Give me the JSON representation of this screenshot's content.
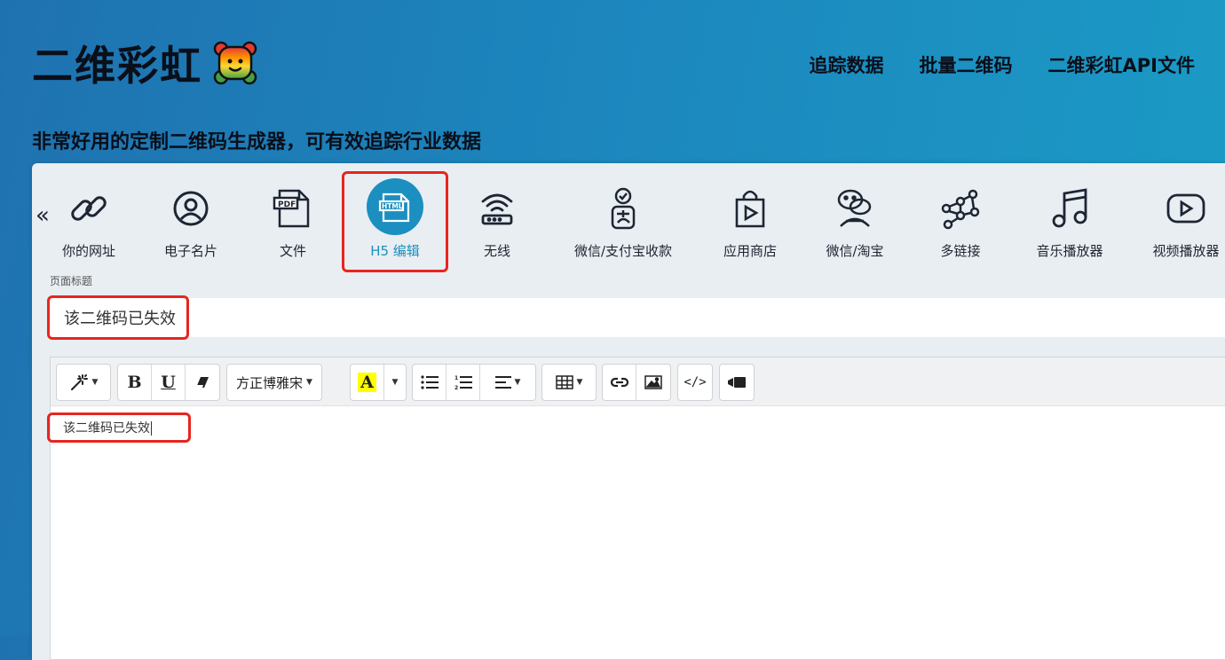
{
  "header": {
    "logo_text": "二维彩虹",
    "nav": [
      "追踪数据",
      "批量二维码",
      "二维彩虹API文件"
    ],
    "tagline": "非常好用的定制二维码生成器，可有效追踪行业数据"
  },
  "types": {
    "prev_arrow": "«",
    "items": [
      {
        "label": "你的网址",
        "icon": "link-icon"
      },
      {
        "label": "电子名片",
        "icon": "user-icon"
      },
      {
        "label": "文件",
        "icon": "pdf-file-icon"
      },
      {
        "label": "H5 编辑",
        "icon": "html-file-icon",
        "active": true
      },
      {
        "label": "无线",
        "icon": "wifi-router-icon"
      },
      {
        "label": "微信/支付宝收款",
        "icon": "payment-icon"
      },
      {
        "label": "应用商店",
        "icon": "app-store-bag-icon"
      },
      {
        "label": "微信/淘宝",
        "icon": "wechat-icon"
      },
      {
        "label": "多链接",
        "icon": "multi-link-icon"
      },
      {
        "label": "音乐播放器",
        "icon": "music-note-icon"
      },
      {
        "label": "视频播放器",
        "icon": "video-play-icon"
      }
    ]
  },
  "form": {
    "title_label": "页面标题",
    "title_value": "该二维码已失效"
  },
  "editor": {
    "font_name": "方正博雅宋",
    "content": "该二维码已失效",
    "toolbar": {
      "bold": "B",
      "underline": "U",
      "highlight": "A",
      "code": "</>"
    }
  },
  "colors": {
    "accent": "#1b8fbf",
    "highlight_yellow": "#ffff00",
    "annotation_red": "#e8251f"
  }
}
